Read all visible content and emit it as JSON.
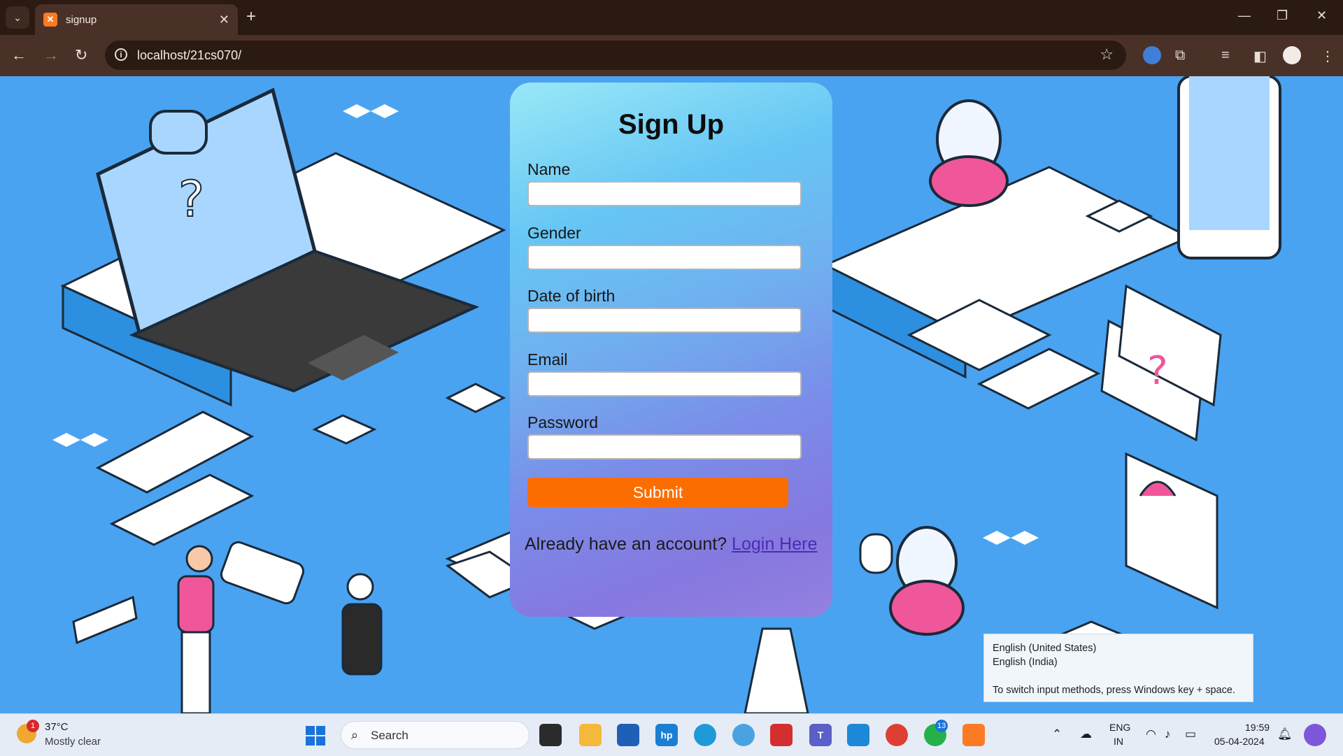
{
  "browser": {
    "tab_title": "signup",
    "url": "localhost/21cs070/"
  },
  "form": {
    "title": "Sign Up",
    "fields": [
      {
        "label": "Name",
        "value": ""
      },
      {
        "label": "Gender",
        "value": ""
      },
      {
        "label": "Date of birth",
        "value": ""
      },
      {
        "label": "Email",
        "value": ""
      },
      {
        "label": "Password",
        "value": ""
      }
    ],
    "submit_label": "Submit",
    "account_prompt": "Already have an account?",
    "login_link": "Login Here"
  },
  "ime_tooltip": {
    "line1": "English (United States)",
    "line2": "English (India)",
    "hint": "To switch input methods, press Windows key + space."
  },
  "taskbar": {
    "weather_badge": "1",
    "weather_temp": "37°C",
    "weather_desc": "Mostly clear",
    "search_placeholder": "Search",
    "whatsapp_badge": "13",
    "lang_top": "ENG",
    "lang_bottom": "IN",
    "time": "19:59",
    "date": "05-04-2024"
  },
  "colors": {
    "submit": "#fc6d00",
    "link": "#4a2db6",
    "page_bg": "#4aa3f0"
  }
}
